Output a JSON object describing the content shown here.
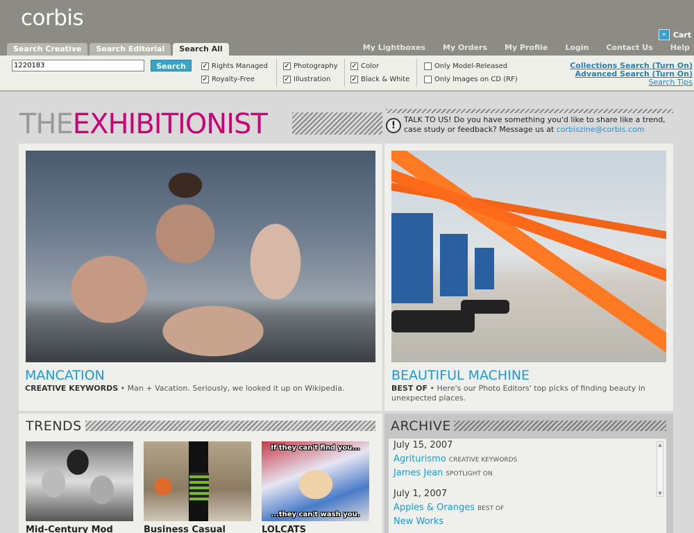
{
  "brand": {
    "logo": "corbis"
  },
  "header": {
    "tabs": [
      {
        "label": "Search Creative"
      },
      {
        "label": "Search Editorial"
      },
      {
        "label": "Search All"
      }
    ],
    "links": [
      "My Lightboxes",
      "My Orders",
      "My Profile",
      "Login",
      "Contact Us",
      "Help"
    ],
    "cart": "Cart"
  },
  "search": {
    "value": "1220183",
    "button": "Search",
    "filters": {
      "rights_managed": "Rights Managed",
      "royalty_free": "Royalty-Free",
      "photography": "Photography",
      "illustration": "Illustration",
      "color": "Color",
      "black_white": "Black & White",
      "model_released": "Only Model-Released",
      "images_on_cd": "Only Images on CD (RF)"
    },
    "links": {
      "collections": "Collections Search (Turn On)",
      "advanced": "Advanced Search (Turn On)",
      "tips": "Search Tips"
    }
  },
  "banner": {
    "title_prefix": "THE",
    "title_main": "EXHIBITIONIST",
    "talk_text": "TALK TO US!  Do you have something you'd like to share like a trend, case study or feedback?  Message us at ",
    "email": "corbiszine@corbis.com"
  },
  "features": [
    {
      "title": "MANCATION",
      "category": "CREATIVE KEYWORDS",
      "description": " • Man + Vacation. Seriously, we looked it up on Wikipedia."
    },
    {
      "title": "BEAUTIFUL MACHINE",
      "category": "BEST OF",
      "description": " • Here's our Photo Editors' top picks of finding beauty in unexpected places."
    }
  ],
  "trends": {
    "heading": "TRENDS",
    "items": [
      {
        "label": "Mid-Century Mod"
      },
      {
        "label": "Business Casual"
      },
      {
        "label": "LOLCATS",
        "caption_top": "If they can't find you...",
        "caption_bottom": "...they can't wash you."
      }
    ]
  },
  "archive": {
    "heading": "ARCHIVE",
    "entries": [
      {
        "date": "July 15, 2007"
      },
      {
        "title": "Agriturismo",
        "tag": "CREATIVE KEYWORDS"
      },
      {
        "title": "James Jean",
        "tag": "SPOTLIGHT ON"
      },
      {
        "date": "July 1, 2007"
      },
      {
        "title": "Apples & Oranges",
        "tag": "BEST OF"
      },
      {
        "title": "New Works",
        "tag": ""
      }
    ]
  },
  "colors": {
    "header_bg": "#8c8c84",
    "accent_blue": "#1a9ad6",
    "accent_magenta": "#cc0077",
    "search_button": "#38a4c8"
  }
}
